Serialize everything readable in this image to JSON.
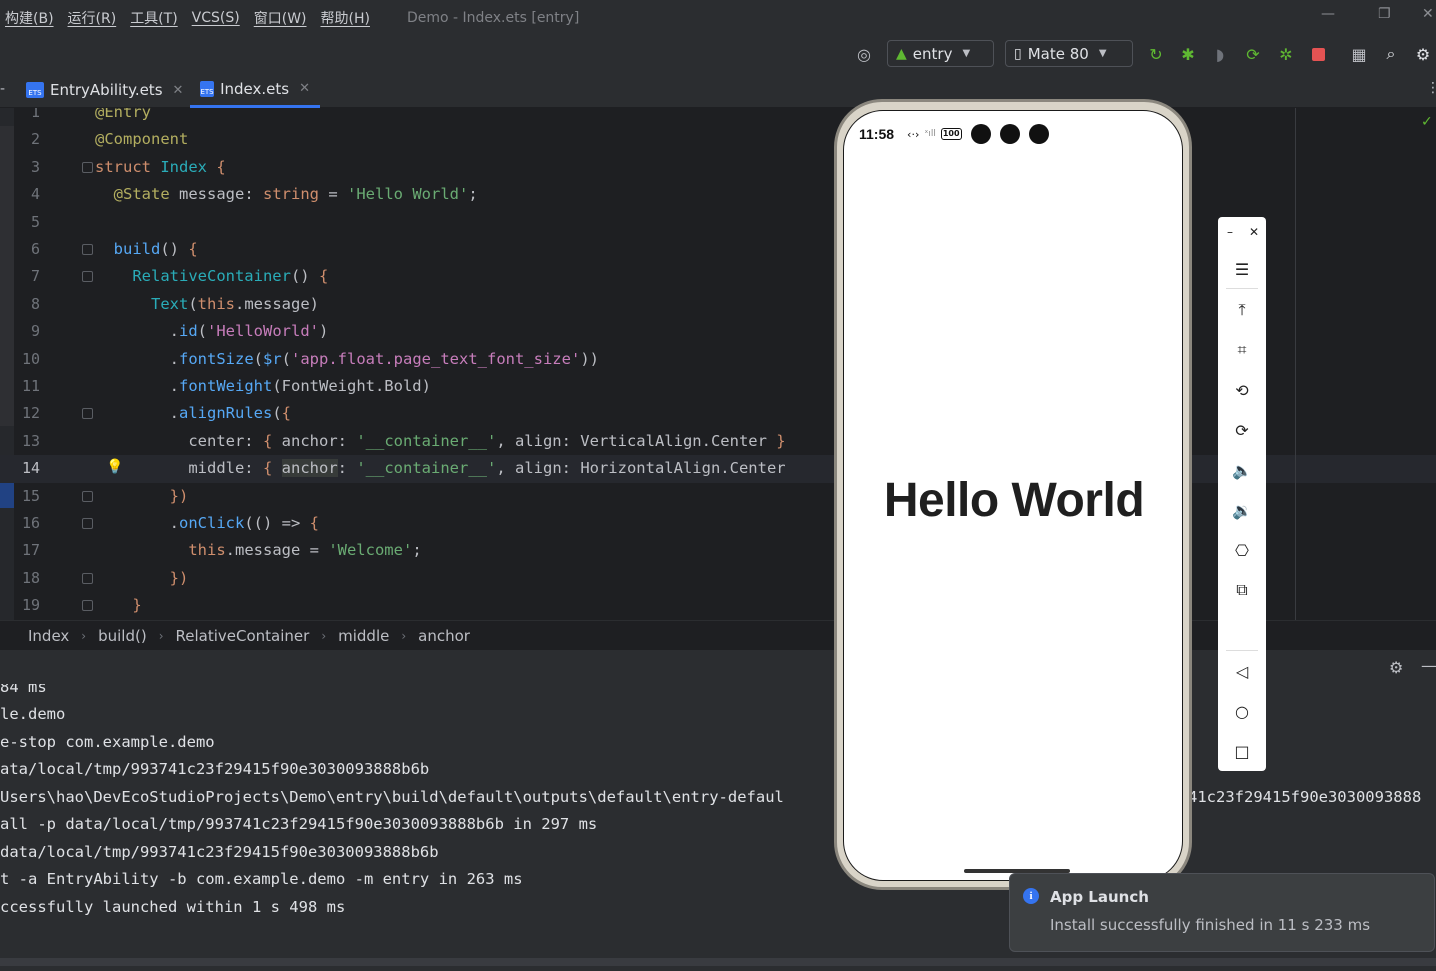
{
  "menu": [
    "构建(B)",
    "运行(R)",
    "工具(T)",
    "VCS(S)",
    "窗口(W)",
    "帮助(H)"
  ],
  "window_title": "Demo - Index.ets [entry]",
  "toolbar": {
    "module_combo": "entry",
    "device_combo": "Mate 80"
  },
  "tabs": [
    {
      "label": "EntryAbility.ets",
      "icon_text": "ETS"
    },
    {
      "label": "Index.ets",
      "icon_text": "ETS"
    }
  ],
  "code": {
    "line_numbers": [
      "1",
      "2",
      "3",
      "4",
      "5",
      "6",
      "7",
      "8",
      "9",
      "10",
      "11",
      "12",
      "13",
      "14",
      "15",
      "16",
      "17",
      "18",
      "19"
    ],
    "current_line": "14"
  },
  "breadcrumb": [
    "Index",
    "build()",
    "RelativeContainer",
    "middle",
    "anchor"
  ],
  "console_lines": [
    "84 ms",
    "le.demo",
    "e-stop com.example.demo",
    "ata/local/tmp/993741c23f29415f90e3030093888b6b",
    "Users\\hao\\DevEcoStudioProjects\\Demo\\entry\\build\\default\\outputs\\default\\entry-defaul",
    "all -p data/local/tmp/993741c23f29415f90e3030093888b6b in 297 ms",
    "data/local/tmp/993741c23f29415f90e3030093888b6b",
    "t -a EntryAbility -b com.example.demo -m entry in 263 ms",
    "ccessfully launched within 1 s 498 ms"
  ],
  "console_overflow_right": "41c23f29415f90e3030093888",
  "phone": {
    "time": "11:58",
    "battery": "100",
    "hello_text": "Hello World"
  },
  "notification": {
    "title": "App Launch",
    "message": "Install successfully finished in 11 s 233 ms"
  },
  "colors": {
    "accent": "#3574f0",
    "run_green": "#5fb832",
    "stop_red": "#e55353"
  }
}
